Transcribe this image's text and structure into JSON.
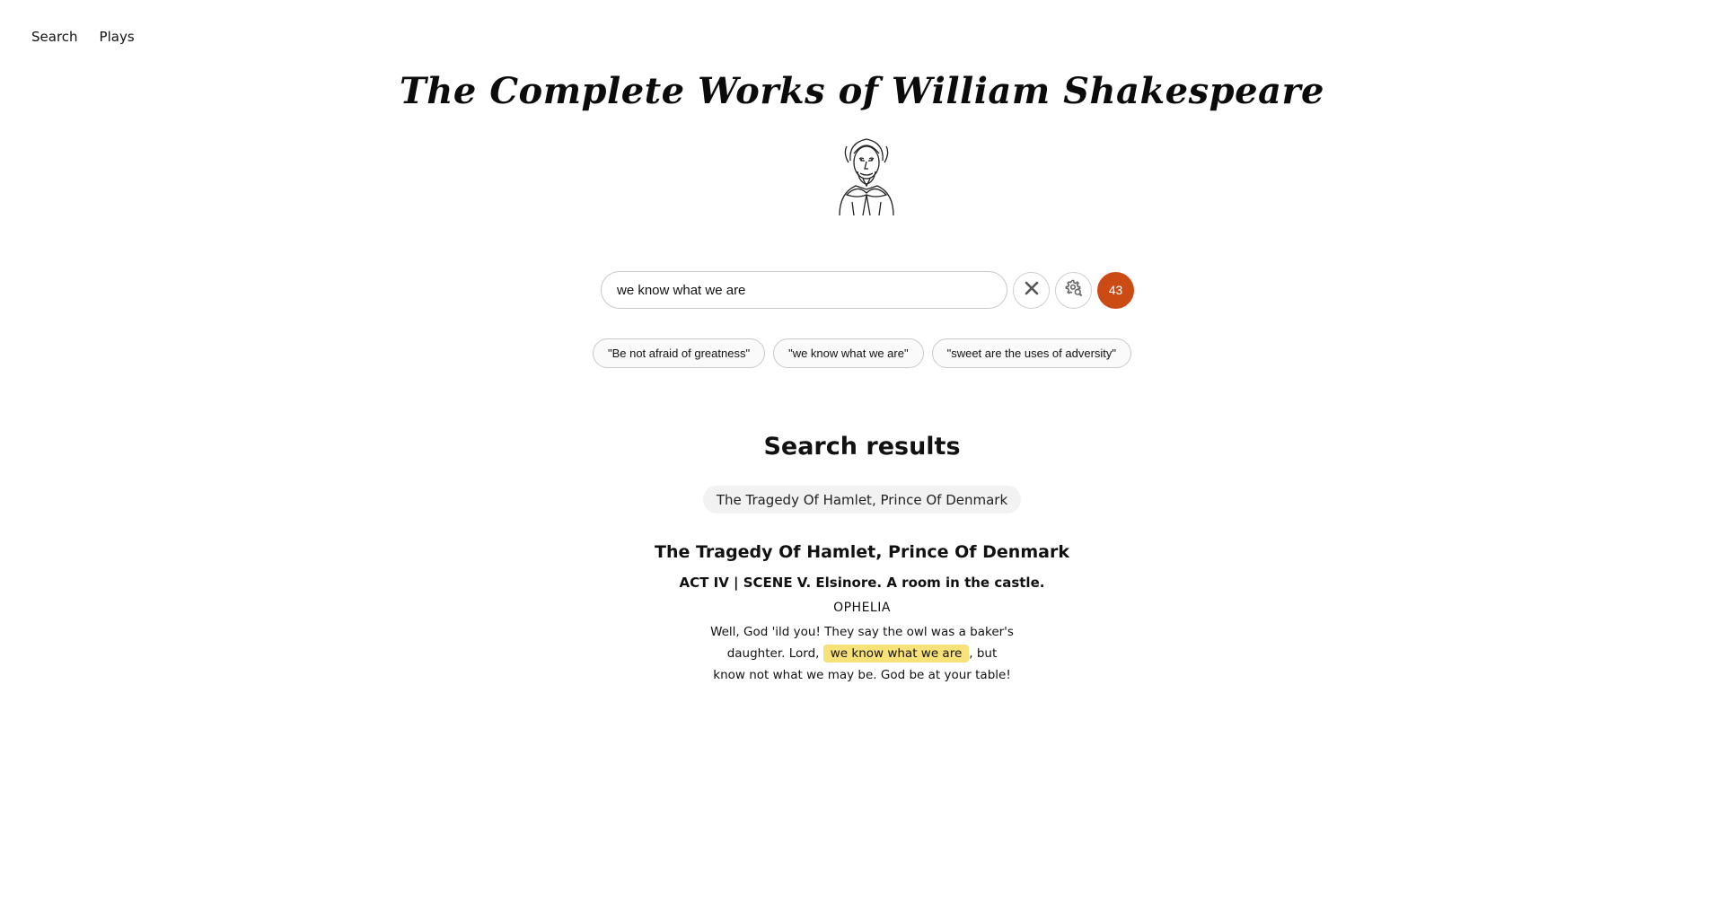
{
  "nav": {
    "search_label": "Search",
    "plays_label": "Plays"
  },
  "header": {
    "title": "The Complete Works of William Shakespeare",
    "portrait_icon": "shakespeare-portrait"
  },
  "search": {
    "value": "we know what we are",
    "clear_icon": "close-icon",
    "advanced_icon": "search-settings-icon",
    "result_count": "43",
    "accent_color": "#cc4a14"
  },
  "suggestions": [
    "\"Be not afraid of greatness\"",
    "\"we know what we are\"",
    "\"sweet are the uses of adversity\""
  ],
  "results": {
    "heading": "Search results",
    "play_filter": "The Tragedy Of Hamlet, Prince Of Denmark",
    "items": [
      {
        "play": "The Tragedy Of Hamlet, Prince Of Denmark",
        "scene": "ACT IV | SCENE V. Elsinore. A room in the castle.",
        "speaker": "OPHELIA",
        "text_before": "Well, God 'ild you! They say the owl was a baker's daughter. Lord, ",
        "text_match": "we know what we are",
        "text_after": ", but know not what we may be. God be at your table!",
        "highlight_color": "#f7e27a"
      }
    ]
  }
}
